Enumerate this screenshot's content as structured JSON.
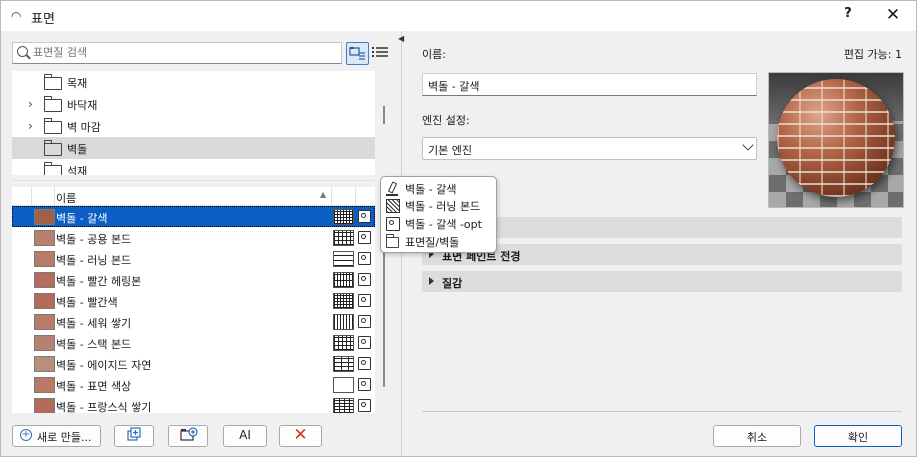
{
  "window": {
    "title": "표면",
    "help_label": "?",
    "close_label": "✕"
  },
  "search": {
    "placeholder": "표면질 검색"
  },
  "tree": {
    "items": [
      {
        "label": "목재",
        "expandable": false
      },
      {
        "label": "바닥재",
        "expandable": true
      },
      {
        "label": "벽 마감",
        "expandable": true
      },
      {
        "label": "벽돌",
        "expandable": false,
        "selected": true
      },
      {
        "label": "석재",
        "expandable": false
      }
    ]
  },
  "list": {
    "header": "이름",
    "rows": [
      {
        "name": "벽돌 - 갈색",
        "swatch": "#a0604a",
        "pattern": "p1",
        "selected": true
      },
      {
        "name": "벽돌 - 공용 본드",
        "swatch": "#b9806c",
        "pattern": "p2"
      },
      {
        "name": "벽돌 - 러닝 본드",
        "swatch": "#b77c69",
        "pattern": "p3"
      },
      {
        "name": "벽돌 - 빨간 헤링본",
        "swatch": "#b46d5e",
        "pattern": "p4"
      },
      {
        "name": "벽돌 - 빨간색",
        "swatch": "#b36a5a",
        "pattern": "p1"
      },
      {
        "name": "벽돌 - 세워 쌓기",
        "swatch": "#ba7c6a",
        "pattern": "p5"
      },
      {
        "name": "벽돌 - 스택 본드",
        "swatch": "#b58170",
        "pattern": "p6"
      },
      {
        "name": "벽돌 - 에이지드 자연",
        "swatch": "#b98e7c",
        "pattern": "p7"
      },
      {
        "name": "벽돌 - 표면 색상",
        "swatch": "#b87a67",
        "pattern": "p8"
      },
      {
        "name": "벽돌 - 프랑스식 쌓기",
        "swatch": "#b06b5b",
        "pattern": "p9"
      }
    ]
  },
  "toolbar": {
    "new_label": "새로 만들...",
    "rename_glyph": "AI",
    "delete_glyph": "✕"
  },
  "popup": {
    "items": [
      {
        "label": "벽돌 - 갈색"
      },
      {
        "label": "벽돌 - 러닝 본드"
      },
      {
        "label": "벽돌 - 갈색 -opt"
      },
      {
        "label": "표면질/벽돌"
      }
    ]
  },
  "details": {
    "name_label": "이름:",
    "editable_label": "편집 가능: 1",
    "name_value": "벽돌 - 갈색",
    "engine_label": "엔진 설정:",
    "engine_value": "기본 엔진",
    "sections": [
      {
        "label": ""
      },
      {
        "label": "표면 페인트 전경"
      },
      {
        "label": "질감"
      }
    ]
  },
  "buttons": {
    "cancel": "취소",
    "ok": "확인"
  },
  "colors": {
    "accent": "#0b5fc4",
    "delete": "#d9361e"
  }
}
